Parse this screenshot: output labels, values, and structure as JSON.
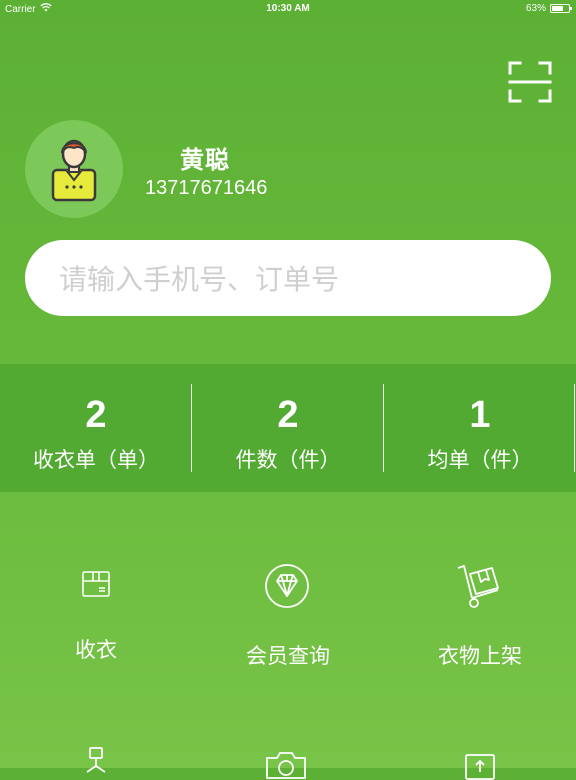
{
  "status_bar": {
    "carrier": "Carrier",
    "time": "10:30 AM",
    "battery": "63%"
  },
  "icons": {
    "scan": "scan-icon",
    "avatar": "user-avatar-icon"
  },
  "user": {
    "name": "黄聪",
    "phone": "13717671646"
  },
  "search": {
    "placeholder": "请输入手机号、订单号"
  },
  "stats": [
    {
      "value": "2",
      "label": "收衣单（单）"
    },
    {
      "value": "2",
      "label": "件数（件）"
    },
    {
      "value": "1",
      "label": "均单（件）"
    }
  ],
  "menu": [
    {
      "label": "收衣",
      "icon": "box-icon"
    },
    {
      "label": "会员查询",
      "icon": "diamond-icon"
    },
    {
      "label": "衣物上架",
      "icon": "hand-truck-icon"
    },
    {
      "label": "",
      "icon": "hanger-icon"
    },
    {
      "label": "",
      "icon": "camera-icon"
    },
    {
      "label": "",
      "icon": "upload-icon"
    }
  ],
  "colors": {
    "primary_green": "#5cb034",
    "stats_bar": "#52aa32",
    "avatar_bg": "#7cc859"
  }
}
